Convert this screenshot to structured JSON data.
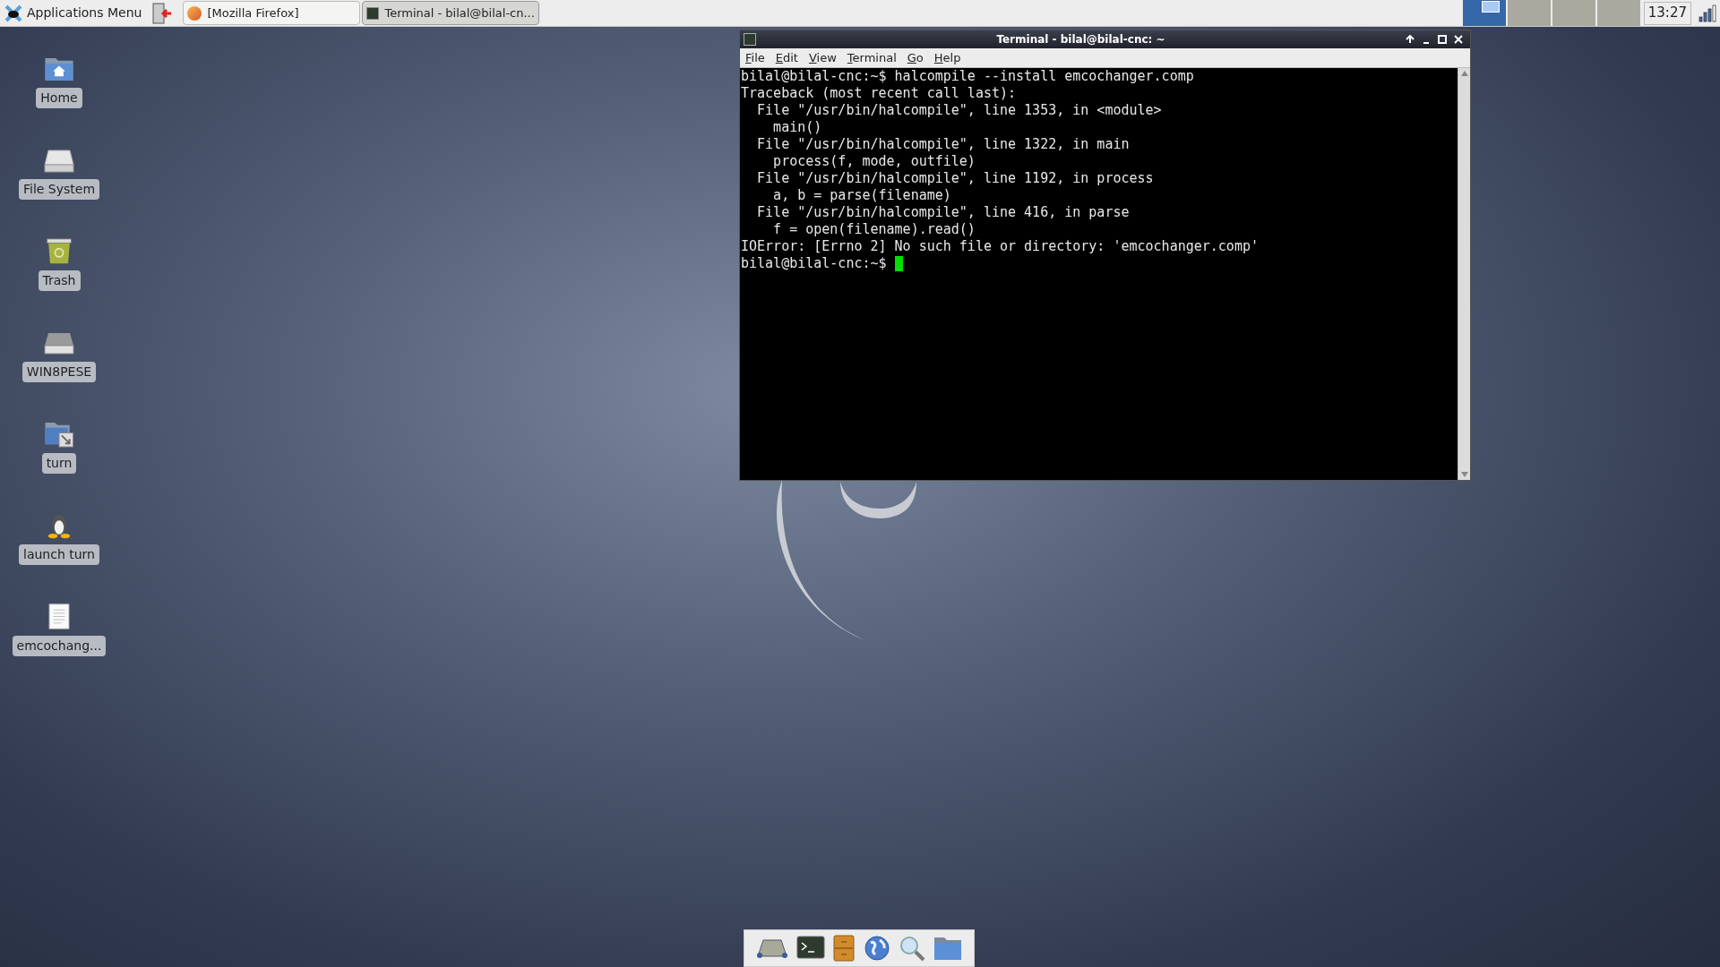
{
  "top_panel": {
    "applications_menu": "Applications Menu",
    "tasks": [
      {
        "label": "[Mozilla Firefox]",
        "kind": "firefox",
        "selected": false
      },
      {
        "label": "Terminal - bilal@bilal-cn...",
        "kind": "terminal",
        "selected": true
      }
    ],
    "workspaces": [
      {
        "selected": true
      },
      {
        "selected": false
      },
      {
        "selected": false
      },
      {
        "selected": false
      }
    ],
    "clock": "13:27"
  },
  "desktop_icons": [
    {
      "label": "Home",
      "kind": "home"
    },
    {
      "label": "File System",
      "kind": "drive"
    },
    {
      "label": "Trash",
      "kind": "trash"
    },
    {
      "label": "WIN8PESE",
      "kind": "disk"
    },
    {
      "label": "turn",
      "kind": "link"
    },
    {
      "label": "launch turn",
      "kind": "penguin"
    },
    {
      "label": "emcochang...",
      "kind": "file"
    }
  ],
  "terminal": {
    "title": "Terminal - bilal@bilal-cnc: ~",
    "menu": [
      "File",
      "Edit",
      "View",
      "Terminal",
      "Go",
      "Help"
    ],
    "lines": [
      "bilal@bilal-cnc:~$ halcompile --install emcochanger.comp",
      "Traceback (most recent call last):",
      "  File \"/usr/bin/halcompile\", line 1353, in <module>",
      "    main()",
      "  File \"/usr/bin/halcompile\", line 1322, in main",
      "    process(f, mode, outfile)",
      "  File \"/usr/bin/halcompile\", line 1192, in process",
      "    a, b = parse(filename)",
      "  File \"/usr/bin/halcompile\", line 416, in parse",
      "    f = open(filename).read()",
      "IOError: [Errno 2] No such file or directory: 'emcochanger.comp'"
    ],
    "prompt": "bilal@bilal-cnc:~$ "
  },
  "dock": [
    {
      "kind": "desktop"
    },
    {
      "kind": "terminal"
    },
    {
      "kind": "cabinet"
    },
    {
      "kind": "globe"
    },
    {
      "kind": "search"
    },
    {
      "kind": "folder"
    }
  ]
}
